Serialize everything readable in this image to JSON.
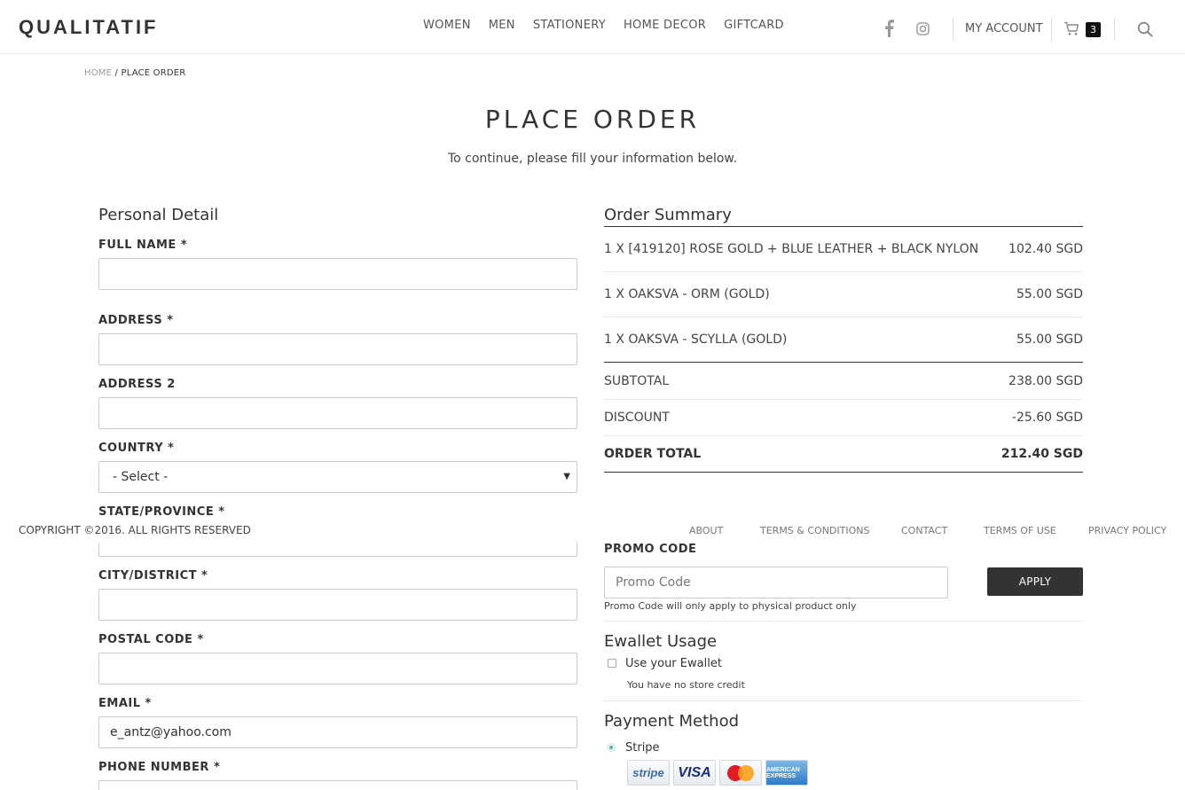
{
  "header": {
    "logo": "QUALITATIF",
    "nav": [
      "WOMEN",
      "MEN",
      "STATIONERY",
      "HOME DECOR",
      "GIFTCARD"
    ],
    "my_account": "MY ACCOUNT",
    "cart_count": "3"
  },
  "breadcrumb": {
    "home": "HOME",
    "sep": " / ",
    "current": "PLACE ORDER"
  },
  "page": {
    "title": "PLACE ORDER",
    "subtitle": "To continue, please fill your information below."
  },
  "personal": {
    "title": "Personal Detail",
    "full_name_label": "FULL NAME *",
    "full_name_value": "",
    "address_label": "ADDRESS *",
    "address_value": "",
    "address2_label": "ADDRESS 2",
    "address2_value": "",
    "country_label": "COUNTRY *",
    "country_value": "- Select -",
    "state_label": "STATE/PROVINCE *",
    "city_label": "CITY/DISTRICT *",
    "city_value": "",
    "postal_label": "POSTAL CODE *",
    "postal_value": "",
    "email_label": "EMAIL *",
    "email_value": "e_antz@yahoo.com",
    "phone_label": "PHONE NUMBER *"
  },
  "summary": {
    "title": "Order Summary",
    "items": [
      {
        "name": "1 X [419120] ROSE GOLD + BLUE LEATHER + BLACK NYLON",
        "price": "102.40 SGD"
      },
      {
        "name": "1 X OAKSVA - ORM (GOLD)",
        "price": "55.00 SGD"
      },
      {
        "name": "1 X OAKSVA - SCYLLA (GOLD)",
        "price": "55.00 SGD"
      }
    ],
    "subtotal_label": "SUBTOTAL",
    "subtotal_value": "238.00 SGD",
    "discount_label": "DISCOUNT",
    "discount_value": "-25.60 SGD",
    "total_label": "ORDER TOTAL",
    "total_value": "212.40 SGD"
  },
  "footer": {
    "copyright": "COPYRIGHT ©2016. ALL RIGHTS RESERVED",
    "links": [
      "ABOUT",
      "TERMS & CONDITIONS",
      "CONTACT",
      "TERMS OF USE",
      "PRIVACY POLICY"
    ]
  },
  "promo": {
    "label": "PROMO CODE",
    "placeholder": "Promo Code",
    "apply": "APPLY",
    "note": "Promo Code will only apply to physical product only"
  },
  "ewallet": {
    "title": "Ewallet Usage",
    "option": "Use your Ewallet",
    "note": "You have no store credit"
  },
  "payment": {
    "title": "Payment Method",
    "option": "Stripe",
    "cards": [
      "stripe",
      "VISA",
      "",
      "AMERICAN EXPRESS"
    ]
  },
  "colors": {
    "accent": "#333333",
    "radio": "#56b3a5"
  }
}
